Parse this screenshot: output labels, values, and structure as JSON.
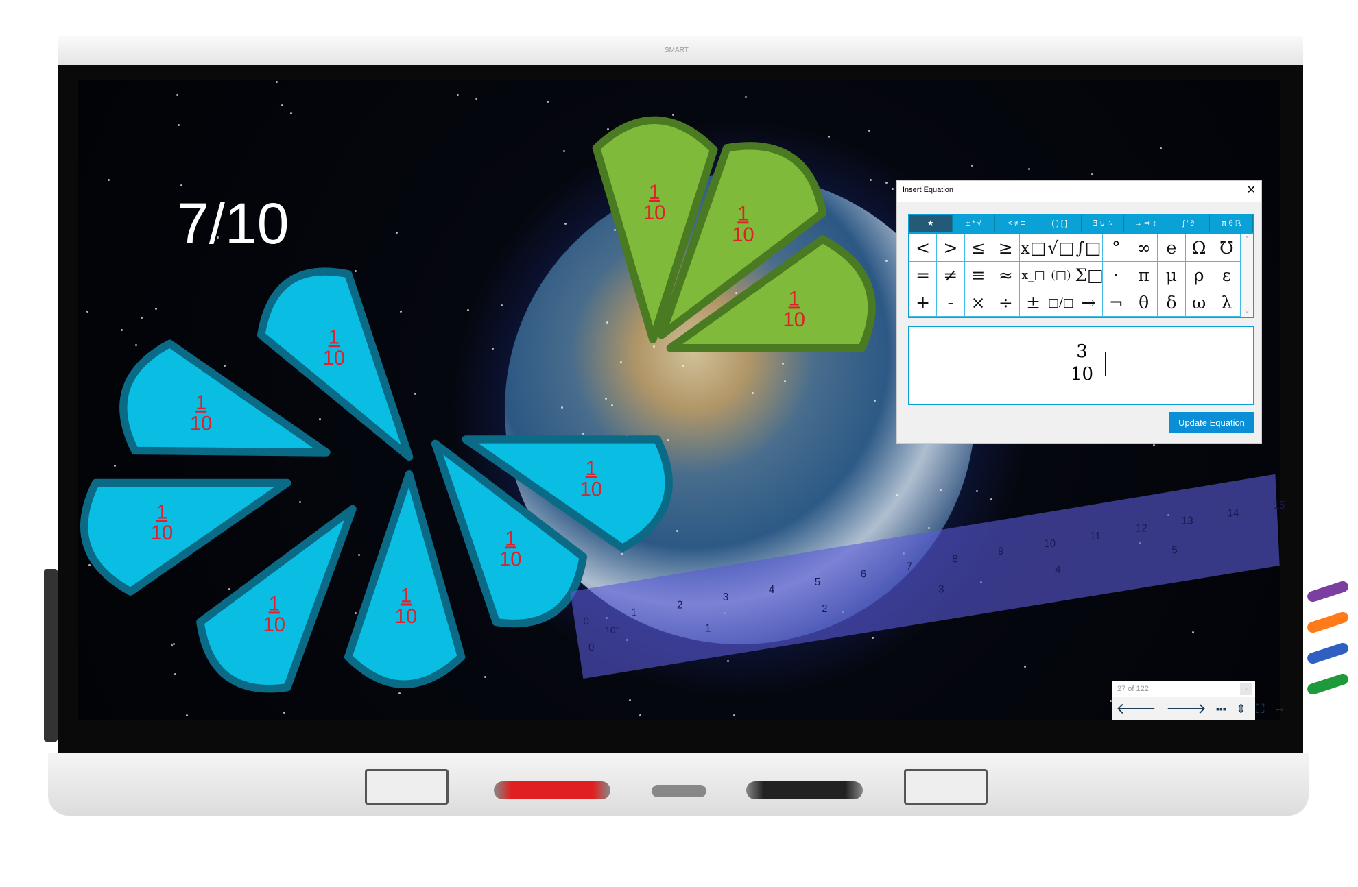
{
  "device": {
    "brand": "SMART"
  },
  "canvas": {
    "big_fraction": "7/10",
    "wedge_label": {
      "numerator": "1",
      "denominator": "10"
    },
    "blue_wedge_count": 7,
    "green_wedge_count": 3,
    "colors": {
      "blue": "#0abde3",
      "blue_edge": "#0b6a86",
      "green": "#7fba3a",
      "green_edge": "#4a7a22",
      "label": "#e0202a",
      "ruler": "#5a5ad8"
    },
    "ruler": {
      "cm_ticks": [
        "1",
        "2",
        "3",
        "4",
        "5",
        "6",
        "7",
        "8",
        "9",
        "10",
        "11",
        "12",
        "13",
        "14",
        "15"
      ],
      "inch_ticks": [
        "1",
        "2",
        "3",
        "4",
        "5"
      ],
      "zero": "0",
      "angle": "10°"
    }
  },
  "dialog": {
    "title": "Insert Equation",
    "tabs": [
      "★",
      "± * √",
      "< ≠ ≡",
      "( ) [ ]",
      "∃ ∪ ∴",
      "→ ⇒ ↕",
      "∫ ′ ∂",
      "π θ ℝ"
    ],
    "active_tab": 0,
    "symbols": [
      [
        "<",
        ">",
        "≤",
        "≥",
        "x□",
        "√□",
        "∫□",
        "°",
        "∞",
        "e",
        "Ω",
        "℧"
      ],
      [
        "=",
        "≠",
        "≡",
        "≈",
        "x_□",
        "(□)",
        "Σ□",
        "·",
        "π",
        "μ",
        "ρ",
        "ε"
      ],
      [
        "+",
        "-",
        "×",
        "÷",
        "±",
        "□/□",
        "→",
        "¬",
        "θ",
        "δ",
        "ω",
        "λ"
      ]
    ],
    "equation": {
      "numerator": "3",
      "denominator": "10"
    },
    "update_button": "Update Equation"
  },
  "page_nav": {
    "page": "27 of 122",
    "close": "×",
    "buttons": [
      "previous-page",
      "next-page",
      "page-sorter",
      "fit-page",
      "fullscreen",
      "resize"
    ]
  }
}
